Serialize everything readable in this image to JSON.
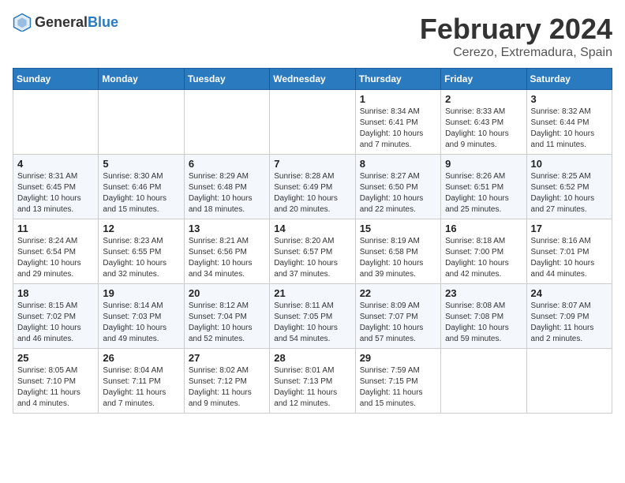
{
  "header": {
    "logo_general": "General",
    "logo_blue": "Blue",
    "month_title": "February 2024",
    "location": "Cerezo, Extremadura, Spain"
  },
  "days_of_week": [
    "Sunday",
    "Monday",
    "Tuesday",
    "Wednesday",
    "Thursday",
    "Friday",
    "Saturday"
  ],
  "weeks": [
    [
      {
        "day": "",
        "info": ""
      },
      {
        "day": "",
        "info": ""
      },
      {
        "day": "",
        "info": ""
      },
      {
        "day": "",
        "info": ""
      },
      {
        "day": "1",
        "info": "Sunrise: 8:34 AM\nSunset: 6:41 PM\nDaylight: 10 hours\nand 7 minutes."
      },
      {
        "day": "2",
        "info": "Sunrise: 8:33 AM\nSunset: 6:43 PM\nDaylight: 10 hours\nand 9 minutes."
      },
      {
        "day": "3",
        "info": "Sunrise: 8:32 AM\nSunset: 6:44 PM\nDaylight: 10 hours\nand 11 minutes."
      }
    ],
    [
      {
        "day": "4",
        "info": "Sunrise: 8:31 AM\nSunset: 6:45 PM\nDaylight: 10 hours\nand 13 minutes."
      },
      {
        "day": "5",
        "info": "Sunrise: 8:30 AM\nSunset: 6:46 PM\nDaylight: 10 hours\nand 15 minutes."
      },
      {
        "day": "6",
        "info": "Sunrise: 8:29 AM\nSunset: 6:48 PM\nDaylight: 10 hours\nand 18 minutes."
      },
      {
        "day": "7",
        "info": "Sunrise: 8:28 AM\nSunset: 6:49 PM\nDaylight: 10 hours\nand 20 minutes."
      },
      {
        "day": "8",
        "info": "Sunrise: 8:27 AM\nSunset: 6:50 PM\nDaylight: 10 hours\nand 22 minutes."
      },
      {
        "day": "9",
        "info": "Sunrise: 8:26 AM\nSunset: 6:51 PM\nDaylight: 10 hours\nand 25 minutes."
      },
      {
        "day": "10",
        "info": "Sunrise: 8:25 AM\nSunset: 6:52 PM\nDaylight: 10 hours\nand 27 minutes."
      }
    ],
    [
      {
        "day": "11",
        "info": "Sunrise: 8:24 AM\nSunset: 6:54 PM\nDaylight: 10 hours\nand 29 minutes."
      },
      {
        "day": "12",
        "info": "Sunrise: 8:23 AM\nSunset: 6:55 PM\nDaylight: 10 hours\nand 32 minutes."
      },
      {
        "day": "13",
        "info": "Sunrise: 8:21 AM\nSunset: 6:56 PM\nDaylight: 10 hours\nand 34 minutes."
      },
      {
        "day": "14",
        "info": "Sunrise: 8:20 AM\nSunset: 6:57 PM\nDaylight: 10 hours\nand 37 minutes."
      },
      {
        "day": "15",
        "info": "Sunrise: 8:19 AM\nSunset: 6:58 PM\nDaylight: 10 hours\nand 39 minutes."
      },
      {
        "day": "16",
        "info": "Sunrise: 8:18 AM\nSunset: 7:00 PM\nDaylight: 10 hours\nand 42 minutes."
      },
      {
        "day": "17",
        "info": "Sunrise: 8:16 AM\nSunset: 7:01 PM\nDaylight: 10 hours\nand 44 minutes."
      }
    ],
    [
      {
        "day": "18",
        "info": "Sunrise: 8:15 AM\nSunset: 7:02 PM\nDaylight: 10 hours\nand 46 minutes."
      },
      {
        "day": "19",
        "info": "Sunrise: 8:14 AM\nSunset: 7:03 PM\nDaylight: 10 hours\nand 49 minutes."
      },
      {
        "day": "20",
        "info": "Sunrise: 8:12 AM\nSunset: 7:04 PM\nDaylight: 10 hours\nand 52 minutes."
      },
      {
        "day": "21",
        "info": "Sunrise: 8:11 AM\nSunset: 7:05 PM\nDaylight: 10 hours\nand 54 minutes."
      },
      {
        "day": "22",
        "info": "Sunrise: 8:09 AM\nSunset: 7:07 PM\nDaylight: 10 hours\nand 57 minutes."
      },
      {
        "day": "23",
        "info": "Sunrise: 8:08 AM\nSunset: 7:08 PM\nDaylight: 10 hours\nand 59 minutes."
      },
      {
        "day": "24",
        "info": "Sunrise: 8:07 AM\nSunset: 7:09 PM\nDaylight: 11 hours\nand 2 minutes."
      }
    ],
    [
      {
        "day": "25",
        "info": "Sunrise: 8:05 AM\nSunset: 7:10 PM\nDaylight: 11 hours\nand 4 minutes."
      },
      {
        "day": "26",
        "info": "Sunrise: 8:04 AM\nSunset: 7:11 PM\nDaylight: 11 hours\nand 7 minutes."
      },
      {
        "day": "27",
        "info": "Sunrise: 8:02 AM\nSunset: 7:12 PM\nDaylight: 11 hours\nand 9 minutes."
      },
      {
        "day": "28",
        "info": "Sunrise: 8:01 AM\nSunset: 7:13 PM\nDaylight: 11 hours\nand 12 minutes."
      },
      {
        "day": "29",
        "info": "Sunrise: 7:59 AM\nSunset: 7:15 PM\nDaylight: 11 hours\nand 15 minutes."
      },
      {
        "day": "",
        "info": ""
      },
      {
        "day": "",
        "info": ""
      }
    ]
  ]
}
